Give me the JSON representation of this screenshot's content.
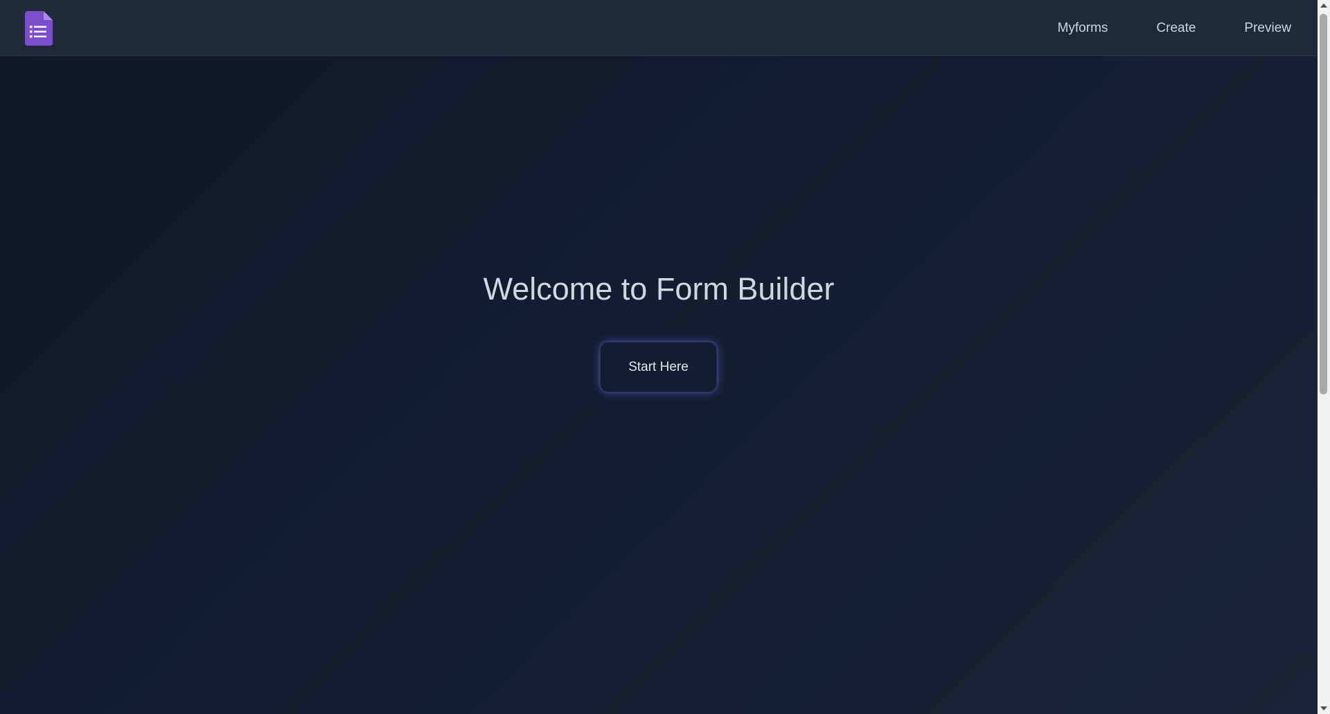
{
  "app": {
    "logo_icon": "form-document-icon",
    "accent_color": "#7c4dcc"
  },
  "nav": {
    "items": [
      {
        "label": "Myforms"
      },
      {
        "label": "Create"
      },
      {
        "label": "Preview"
      }
    ]
  },
  "hero": {
    "title": "Welcome to Form Builder",
    "button_label": "Start Here"
  }
}
